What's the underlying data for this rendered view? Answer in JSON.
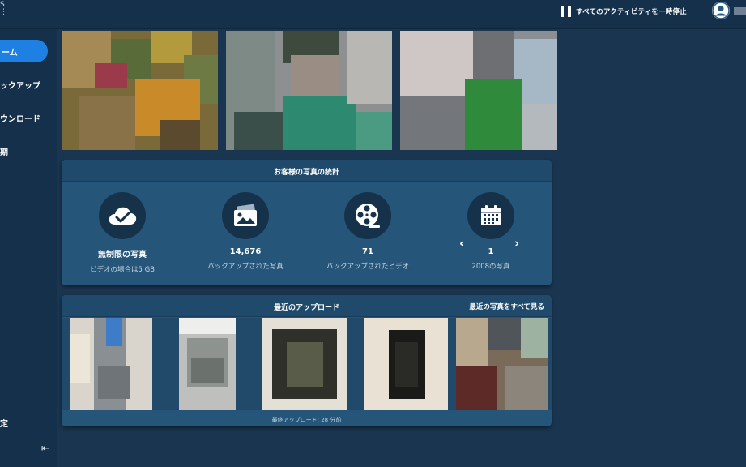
{
  "header": {
    "logo_fragment": "S\n⋮",
    "pause_label": "すべてのアクティビティを一時停止"
  },
  "sidebar": {
    "items": [
      {
        "label": "ーム",
        "icon": "home-icon",
        "active": true
      },
      {
        "label": "ックアップ",
        "icon": "backup-icon",
        "active": false
      },
      {
        "label": "ウンロード",
        "icon": "download-icon",
        "active": false
      },
      {
        "label": "期",
        "icon": "sync-icon",
        "active": false
      },
      {
        "label": "定",
        "icon": "settings-icon",
        "active": false
      }
    ],
    "collapse_icon": "collapse-left-icon"
  },
  "stats": {
    "title": "お客様の写真の統計",
    "items": [
      {
        "icon": "cloud-check-icon",
        "value": "無制限の写真",
        "label": "ビデオの場合は5 GB"
      },
      {
        "icon": "photo-stack-icon",
        "value": "14,676",
        "label": "バックアップされた写真"
      },
      {
        "icon": "film-reel-icon",
        "value": "71",
        "label": "バックアップされたビデオ"
      },
      {
        "icon": "calendar-icon",
        "value": "1",
        "label": "2008の写真"
      }
    ]
  },
  "recent": {
    "title": "最近のアップロード",
    "see_all": "最近の写真をすべて見る",
    "footer": "最終アップロード: 28 分前"
  },
  "colors": {
    "accent": "#1f80e3",
    "background": "#1a3550",
    "card": "#255578",
    "card_header": "#1f4a6b",
    "icon_circle": "#16324b"
  }
}
